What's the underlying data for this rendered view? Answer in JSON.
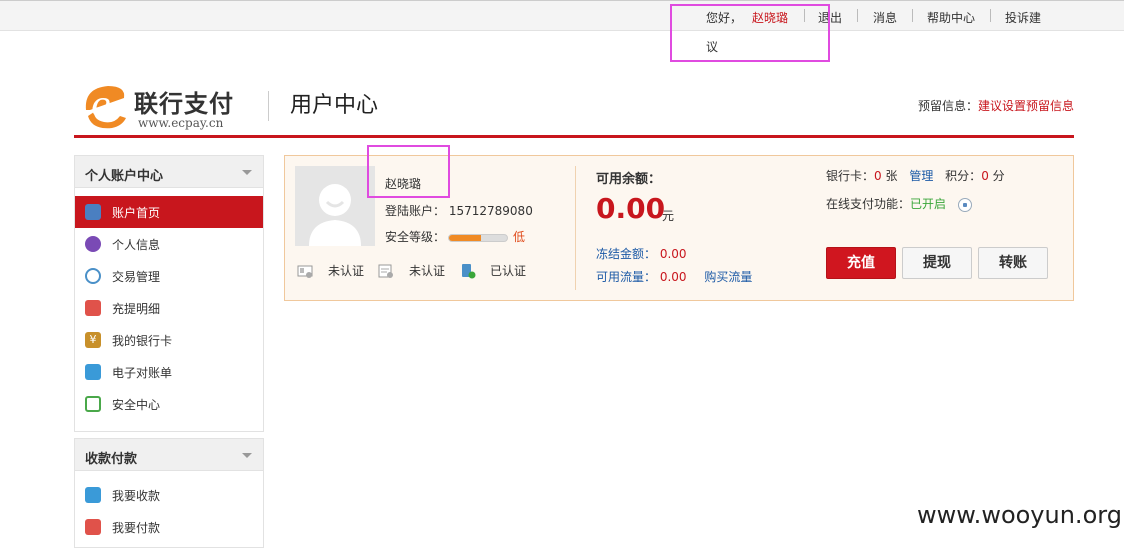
{
  "topbar": {
    "greeting": "您好，",
    "username": "赵晓璐",
    "logout": "退出",
    "messages": "消息",
    "help": "帮助中心",
    "feedback_line1": "投诉建",
    "feedback_line2": "议"
  },
  "header": {
    "logo_cn": "联行支付",
    "logo_url": "www.ecpay.cn",
    "page_title": "用户中心",
    "reserve_label": "预留信息：",
    "reserve_link": "建议设置预留信息"
  },
  "sidebar": {
    "section1_title": "个人账户中心",
    "items": [
      {
        "label": "账户首页",
        "icon": "user-icon",
        "color": "#4a7fc1"
      },
      {
        "label": "个人信息",
        "icon": "profile-icon",
        "color": "#7a4ab5"
      },
      {
        "label": "交易管理",
        "icon": "gear-icon",
        "color": "#4a90c8"
      },
      {
        "label": "充提明细",
        "icon": "tag-icon",
        "color": "#e0524a"
      },
      {
        "label": "我的银行卡",
        "icon": "yen-icon",
        "color": "#c8902a"
      },
      {
        "label": "电子对账单",
        "icon": "drop-icon",
        "color": "#3a9ad8"
      },
      {
        "label": "安全中心",
        "icon": "notebook-icon",
        "color": "#4aa84a"
      }
    ],
    "section2_title": "收款付款",
    "items2": [
      {
        "label": "我要收款",
        "icon": "drop-icon",
        "color": "#3a9ad8"
      },
      {
        "label": "我要付款",
        "icon": "tag-icon",
        "color": "#e0524a"
      }
    ]
  },
  "account": {
    "username": "赵晓璐",
    "login_label": "登陆账户：",
    "login_account": "15712789080",
    "security_label": "安全等级：",
    "security_level": "低",
    "security_fill": 0.55,
    "auth": [
      {
        "label": "未认证",
        "icon": "id-card-icon"
      },
      {
        "label": "未认证",
        "icon": "certificate-icon"
      },
      {
        "label": "已认证",
        "icon": "phone-verified-icon"
      }
    ],
    "balance_label": "可用余额：",
    "balance": "0.00",
    "balance_unit": "元",
    "frozen_label": "冻结金额：",
    "frozen_value": "0.00",
    "flow_label": "可用流量：",
    "flow_value": "0.00",
    "buy_flow": "购买流量",
    "bank_card_label": "银行卡：",
    "bank_card_count": "0",
    "bank_card_unit": "张",
    "manage": "管理",
    "points_label": "积分：",
    "points_value": "0",
    "points_unit": "分",
    "online_pay_label": "在线支付功能：",
    "online_pay_status": "已开启",
    "btn_recharge": "充值",
    "btn_withdraw": "提现",
    "btn_transfer": "转账"
  },
  "watermark": "www.wooyun.org",
  "colors": {
    "brand_red": "#c8161d",
    "link_blue": "#1c5aa6",
    "highlight_box": "#e04be0"
  }
}
